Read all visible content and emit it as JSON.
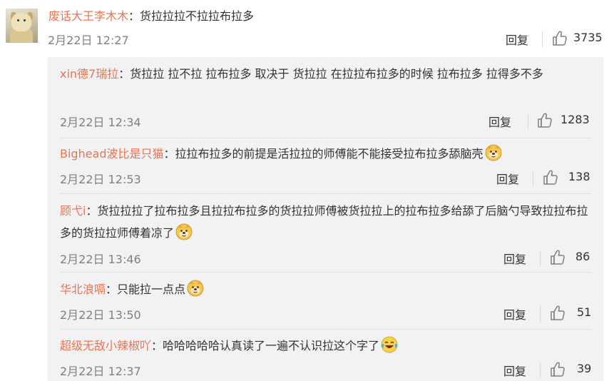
{
  "top_comment": {
    "user": "废话大王李木木",
    "separator": "：",
    "text": "货拉拉拉不拉拉布拉多",
    "time": "2月22日 12:27",
    "reply_label": "回复",
    "likes": "3735"
  },
  "replies": [
    {
      "user": "xin德7瑞拉",
      "separator": "：",
      "text": "货拉拉 拉不拉 拉布拉多 取决于 货拉拉 在拉拉布拉多的时候 拉布拉多 拉得多不多",
      "time": "2月22日 12:34",
      "reply_label": "回复",
      "likes": "1283",
      "emoji": ""
    },
    {
      "user": "Bighead波比是只猫",
      "separator": "：",
      "text": "拉拉布拉多的前提是活拉拉的师傅能不能接受拉布拉多舔脑壳",
      "time": "2月22日 12:53",
      "reply_label": "回复",
      "likes": "138",
      "emoji": "doge-emoji"
    },
    {
      "user": "顾弋i",
      "separator": "：",
      "text": "货拉拉拉了拉布拉多且拉拉布拉多的货拉拉师傅被货拉拉上的拉布拉多给舔了后脑勺导致拉拉布拉多的货拉拉师傅着凉了",
      "time": "2月22日 13:46",
      "reply_label": "回复",
      "likes": "86",
      "emoji": "doge-emoji"
    },
    {
      "user": "华北浪嗝",
      "separator": "：",
      "text": "只能拉一点点",
      "time": "2月22日 13:50",
      "reply_label": "回复",
      "likes": "51",
      "emoji": "doge-emoji"
    },
    {
      "user": "超级无敌小辣椒吖",
      "separator": "：",
      "text": "哈哈哈哈哈认真读了一遍不认识拉这个字了",
      "time": "2月22日 12:37",
      "reply_label": "回复",
      "likes": "39",
      "emoji": "laugh-cry-emoji"
    }
  ],
  "colors": {
    "username": "#eb7350",
    "time": "#808080",
    "reply_bg": "#f2f2f5"
  }
}
